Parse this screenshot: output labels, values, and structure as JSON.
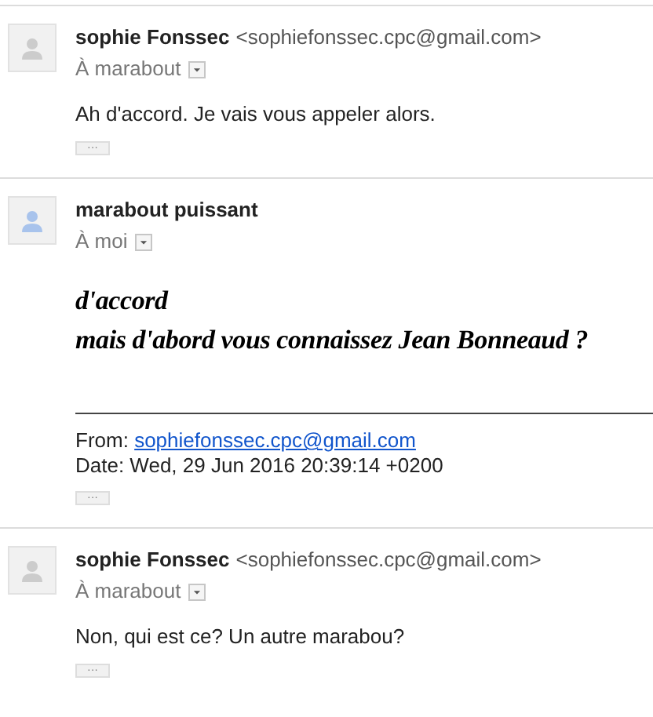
{
  "messages": [
    {
      "kind": "plain",
      "sender": "sophie Fonssec",
      "address": "<sophiefonssec.cpc@gmail.com>",
      "recipient": "À marabout",
      "color": "#cccccc",
      "body": [
        "Ah d'accord. Je vais vous appeler alors."
      ],
      "more": "···"
    },
    {
      "kind": "fancy",
      "sender": "marabout puissant",
      "recipient": "À moi",
      "color": "#a8c3ec",
      "body": [
        "d'accord",
        "mais d'abord vous connaissez Jean Bonneaud ?"
      ],
      "quote": {
        "from_label": "From:",
        "from_link": "sophiefonssec.cpc@gmail.com",
        "date": "Date: Wed, 29 Jun 2016 20:39:14 +0200"
      },
      "more": "···"
    },
    {
      "kind": "plain",
      "sender": "sophie Fonssec",
      "address": "<sophiefonssec.cpc@gmail.com>",
      "recipient": "À marabout",
      "color": "#cccccc",
      "body": [
        "Non, qui est ce? Un autre marabou?"
      ],
      "more": "···"
    }
  ]
}
